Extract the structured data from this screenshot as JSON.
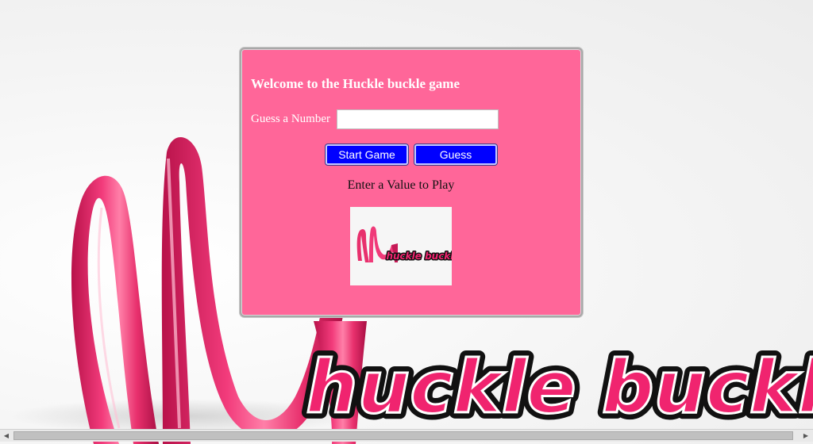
{
  "game": {
    "title": "Welcome to the Huckle buckle game",
    "guess_label": "Guess a Number",
    "guess_value": "",
    "start_button": "Start Game",
    "guess_button": "Guess",
    "status": "Enter a Value to Play"
  },
  "branding": {
    "background_wordmark": "huckle buckle",
    "logo_wordmark": "huckle buckle"
  },
  "colors": {
    "panel": "#ff6699",
    "button": "#0000ff",
    "ribbon": "#e8306d"
  }
}
